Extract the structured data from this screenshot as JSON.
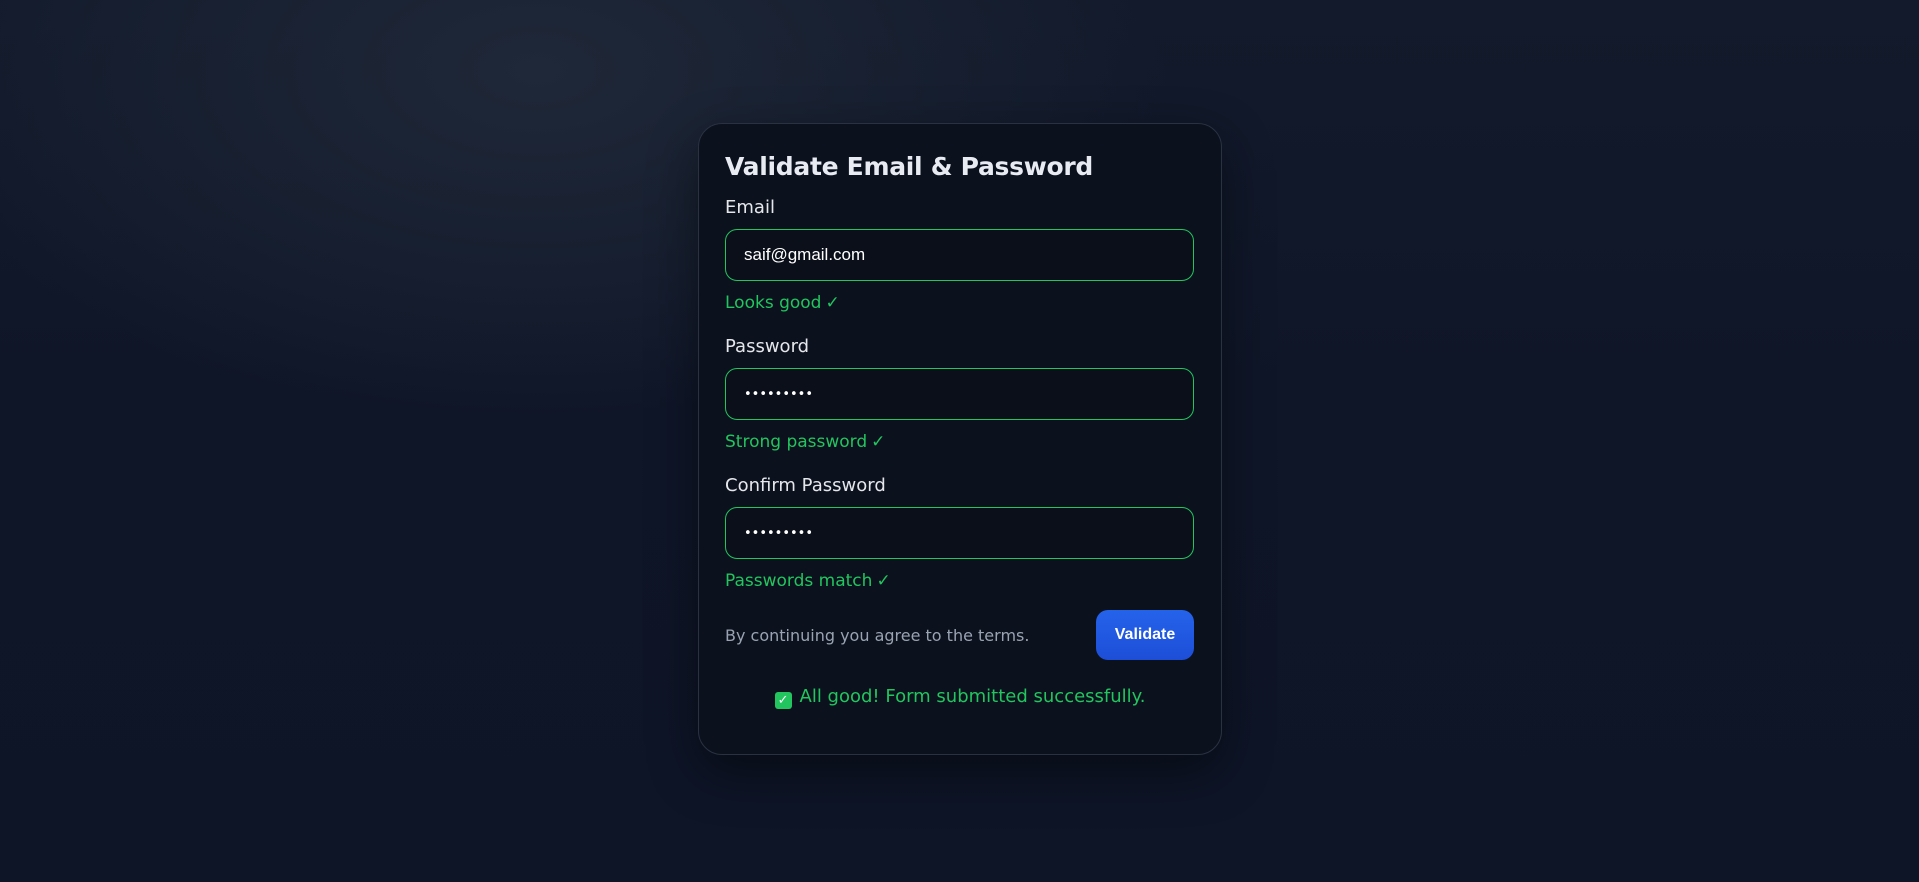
{
  "form": {
    "title": "Validate Email & Password",
    "email": {
      "label": "Email",
      "value": "saif@gmail.com",
      "message": "Looks good",
      "message_icon": "✓"
    },
    "password": {
      "label": "Password",
      "value": "password1",
      "message": "Strong password",
      "message_icon": "✓"
    },
    "confirm": {
      "label": "Confirm Password",
      "value": "password1",
      "message": "Passwords match",
      "message_icon": "✓"
    },
    "terms": "By continuing you agree to the terms.",
    "submit_label": "Validate",
    "success": {
      "icon": "✓",
      "text": "All good! Form submitted successfully."
    }
  },
  "colors": {
    "accent": "#2563eb",
    "success": "#22c55e",
    "card_bg": "#0b111d",
    "page_bg": "#0f1628"
  }
}
